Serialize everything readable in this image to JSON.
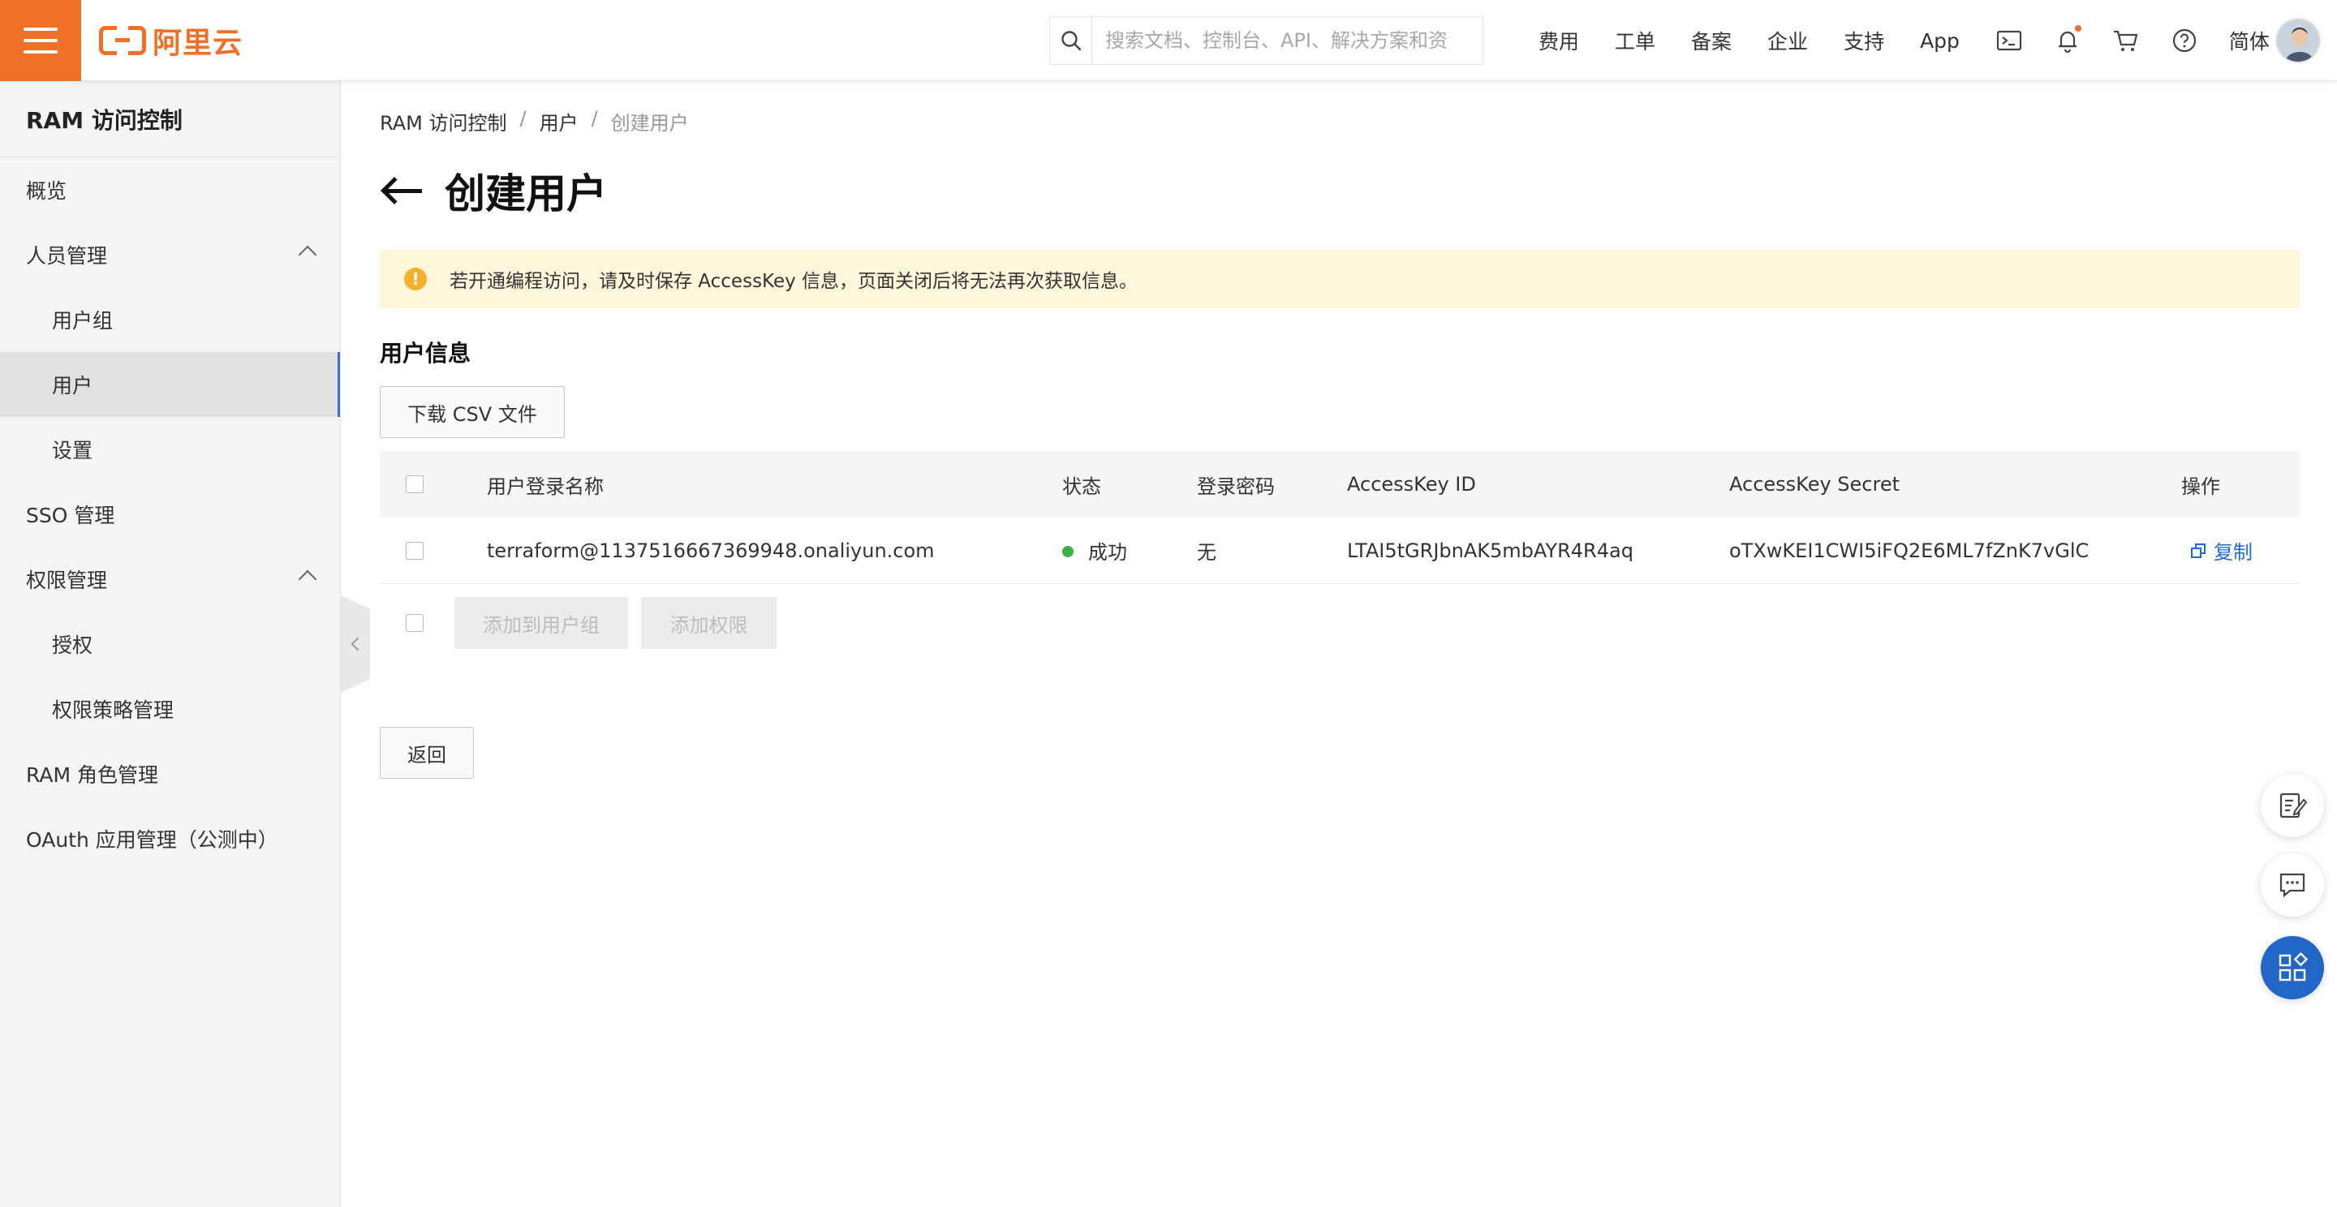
{
  "topbar": {
    "logo_text": "阿里云",
    "search_placeholder": "搜索文档、控制台、API、解决方案和资源",
    "nav": [
      "费用",
      "工单",
      "备案",
      "企业",
      "支持",
      "App"
    ],
    "icons": [
      "terminal-icon",
      "bell-icon",
      "cart-icon",
      "help-icon"
    ],
    "lang": "简体",
    "brand_color": "#f07028"
  },
  "sidebar": {
    "title": "RAM 访问控制",
    "items": [
      {
        "label": "概览",
        "level": 1
      },
      {
        "label": "人员管理",
        "level": 1,
        "expanded": true
      },
      {
        "label": "用户组",
        "level": 2
      },
      {
        "label": "用户",
        "level": 2,
        "active": true
      },
      {
        "label": "设置",
        "level": 2
      },
      {
        "label": "SSO 管理",
        "level": 1
      },
      {
        "label": "权限管理",
        "level": 1,
        "expanded": true
      },
      {
        "label": "授权",
        "level": 2
      },
      {
        "label": "权限策略管理",
        "level": 2
      },
      {
        "label": "RAM 角色管理",
        "level": 1
      },
      {
        "label": "OAuth 应用管理（公测中）",
        "level": 1
      }
    ]
  },
  "breadcrumb": [
    "RAM 访问控制",
    "用户",
    "创建用户"
  ],
  "page": {
    "title": "创建用户",
    "alert": "若开通编程访问，请及时保存 AccessKey 信息，页面关闭后将无法再次获取信息。",
    "section_title": "用户信息",
    "download_button": "下载 CSV 文件",
    "back_button": "返回",
    "bulk_buttons": [
      "添加到用户组",
      "添加权限"
    ]
  },
  "table": {
    "headers": [
      "用户登录名称",
      "状态",
      "登录密码",
      "AccessKey ID",
      "AccessKey Secret",
      "操作"
    ],
    "rows": [
      {
        "login_name": "terraform@1137516667369948.onaliyun.com",
        "status": "成功",
        "password": "无",
        "access_key_id": "LTAI5tGRJbnAK5mbAYR4R4aq",
        "access_key_secret": "oTXwKEI1CWI5iFQ2E6ML7fZnK7vGlC",
        "action": "复制"
      }
    ]
  }
}
